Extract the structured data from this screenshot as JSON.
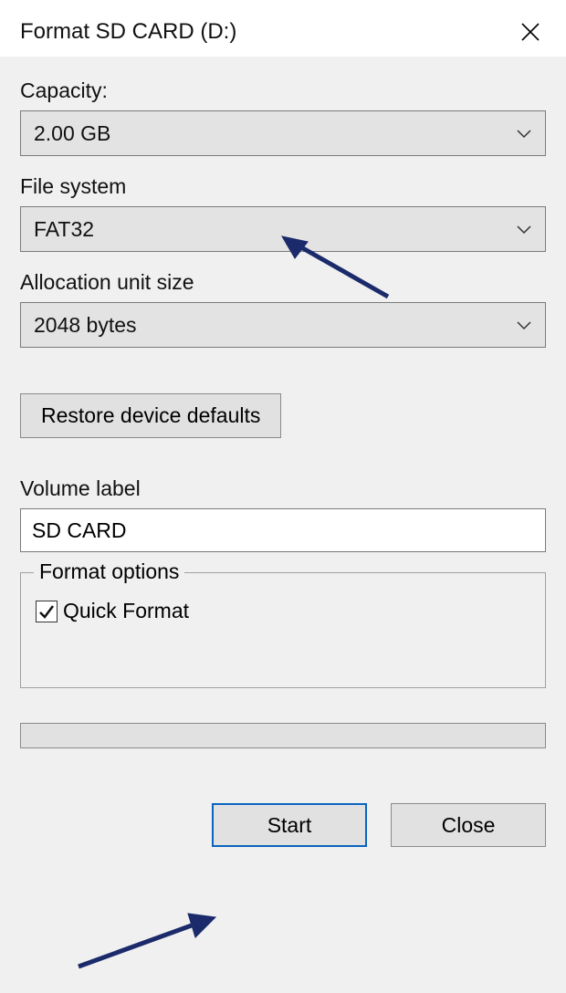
{
  "title": "Format SD CARD (D:)",
  "labels": {
    "capacity": "Capacity:",
    "filesystem": "File system",
    "allocation": "Allocation unit size",
    "volume": "Volume label",
    "format_options": "Format options",
    "quick_format": "Quick Format"
  },
  "values": {
    "capacity": "2.00 GB",
    "filesystem": "FAT32",
    "allocation": "2048 bytes",
    "volume": "SD CARD",
    "quick_format_checked": true
  },
  "buttons": {
    "restore": "Restore device defaults",
    "start": "Start",
    "close": "Close"
  }
}
